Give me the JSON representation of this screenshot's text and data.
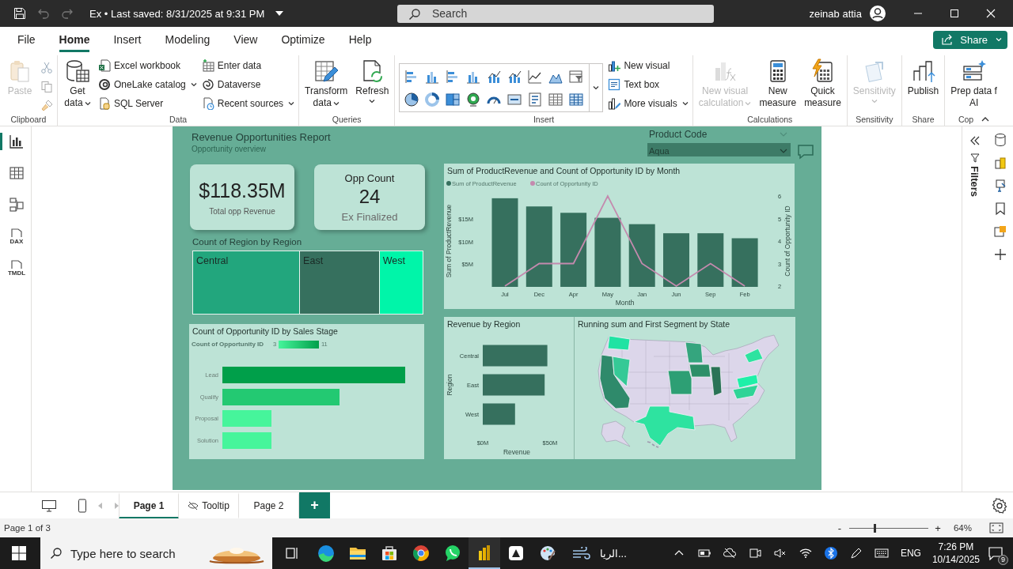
{
  "window": {
    "title": "Ex • Last saved: 8/31/2025 at 9:31 PM",
    "search_placeholder": "Search",
    "user": "zeinab attia"
  },
  "menu": [
    {
      "label": "File",
      "selected": false
    },
    {
      "label": "Home",
      "selected": true
    },
    {
      "label": "Insert",
      "selected": false
    },
    {
      "label": "Modeling",
      "selected": false
    },
    {
      "label": "View",
      "selected": false
    },
    {
      "label": "Optimize",
      "selected": false
    },
    {
      "label": "Help",
      "selected": false
    }
  ],
  "share_button": "Share",
  "ribbon": [
    {
      "label": "Clipboard",
      "items": [
        {
          "kind": "large",
          "label": "Paste",
          "dropdown": false,
          "disabled": true
        },
        {
          "kind": "tools"
        }
      ]
    },
    {
      "label": "Data",
      "items": [
        {
          "kind": "large",
          "label": "Get\ndata",
          "dropdown": true,
          "disabled": false
        },
        {
          "kind": "stack",
          "items": [
            {
              "label": "Excel workbook",
              "dropdown": false
            },
            {
              "label": "OneLake catalog",
              "dropdown": true
            },
            {
              "label": "SQL Server",
              "dropdown": false
            }
          ]
        },
        {
          "kind": "stack",
          "items": [
            {
              "label": "Enter data",
              "dropdown": false
            },
            {
              "label": "Dataverse",
              "dropdown": false
            },
            {
              "label": "Recent sources",
              "dropdown": true
            }
          ]
        }
      ]
    },
    {
      "label": "Queries",
      "items": [
        {
          "kind": "large",
          "label": "Transform\ndata",
          "dropdown": true,
          "disabled": false
        },
        {
          "kind": "large",
          "label": "Refresh",
          "dropdown": true,
          "disabled": false
        }
      ]
    },
    {
      "label": "Insert",
      "items": [
        {
          "kind": "gallery"
        },
        {
          "kind": "stack",
          "items": [
            {
              "label": "New visual",
              "dropdown": false
            },
            {
              "label": "Text box",
              "dropdown": false
            },
            {
              "label": "More visuals",
              "dropdown": true
            }
          ]
        }
      ]
    },
    {
      "label": "Calculations",
      "items": [
        {
          "kind": "large",
          "label": "New visual\ncalculation",
          "dropdown": true,
          "disabled": true
        },
        {
          "kind": "large",
          "label": "New\nmeasure",
          "dropdown": false,
          "disabled": false
        },
        {
          "kind": "large",
          "label": "Quick\nmeasure",
          "dropdown": false,
          "disabled": false
        }
      ]
    },
    {
      "label": "Sensitivity",
      "items": [
        {
          "kind": "large",
          "label": "Sensitivity",
          "dropdown": true,
          "disabled": true
        }
      ]
    },
    {
      "label": "Share",
      "items": [
        {
          "kind": "large",
          "label": "Publish",
          "dropdown": false,
          "disabled": false
        }
      ]
    },
    {
      "label": "Cop",
      "items": [
        {
          "kind": "large",
          "label": "Prep data f\nAI",
          "dropdown": false,
          "disabled": false
        }
      ]
    }
  ],
  "left_rail": [
    {
      "kind": "report",
      "selected": true
    },
    {
      "kind": "table",
      "selected": false
    },
    {
      "kind": "model",
      "selected": false
    },
    {
      "kind": "dax",
      "label": "DAX",
      "selected": false
    },
    {
      "kind": "tmdl",
      "label": "TMDL",
      "selected": false
    }
  ],
  "report": {
    "title": "Revenue Opportunities Report",
    "subtitle": "Opportunity overview",
    "slicer": {
      "label": "Product Code",
      "value": "Aqua"
    },
    "cards": [
      {
        "value": "$118.35M",
        "label": "Total opp Revenue"
      },
      {
        "heading": "Opp Count",
        "value": "24",
        "label": "Ex Finalized"
      }
    ],
    "treemap": {
      "title": "Count of Region by Region",
      "tiles": [
        {
          "label": "Central",
          "color": "#22a67d"
        },
        {
          "label": "East",
          "color": "#36705e"
        },
        {
          "label": "West",
          "color": "#00f5a9"
        }
      ]
    },
    "combo_chart": {
      "title": "Sum of ProductRevenue and Count of Opportunity ID by Month",
      "bars": {
        "chart_data": {
          "type": "bar",
          "xlabel": "Month",
          "ylabel": "Sum of ProductRevenue",
          "categories": [
            "Jul",
            "Dec",
            "Apr",
            "May",
            "Jan",
            "Jun",
            "Sep",
            "Feb"
          ],
          "series": [
            {
              "name": "Sum of ProductRevenue",
              "color": "#36705e",
              "values": [
                19.5,
                17.7,
                16.3,
                15.2,
                13.8,
                11.8,
                11.8,
                10.7
              ]
            }
          ],
          "ylim": [
            0,
            20
          ],
          "yticks": [
            {
              "value": 5,
              "label": "$5M"
            },
            {
              "value": 10,
              "label": "$10M"
            },
            {
              "value": 15,
              "label": "$15M"
            }
          ]
        }
      },
      "line": {
        "chart_data": {
          "type": "line",
          "ylabel": "Count of Opportunity ID",
          "series": [
            {
              "name": "Count of Opportunity ID",
              "color": "#c48aae",
              "values": [
                2,
                3,
                3,
                6,
                3,
                2,
                3,
                2
              ]
            }
          ],
          "ylim": [
            2,
            6
          ],
          "yticks": [
            2,
            3,
            4,
            5,
            6
          ]
        }
      }
    },
    "sales_stage_chart": {
      "title": "Count of Opportunity ID by Sales Stage",
      "legend": {
        "label": "Count of Opportunity ID",
        "min": {
          "label": "3",
          "color": "#46f59b"
        },
        "max": {
          "label": "11",
          "color": "#009f4a"
        }
      },
      "stages": [
        {
          "label": "Lead"
        },
        {
          "label": "Qualify"
        },
        {
          "label": "Proposal"
        },
        {
          "label": "Solution"
        }
      ]
    },
    "region_chart": {
      "title": "Revenue by Region",
      "chart_data": {
        "type": "bar",
        "orientation": "horizontal",
        "xlabel": "Revenue",
        "ylabel": "Region",
        "categories": [
          "Central",
          "East",
          "West"
        ],
        "values": [
          48,
          46,
          24
        ],
        "xlim": [
          0,
          50
        ],
        "xticks": [
          {
            "value": 0,
            "label": "$0M"
          },
          {
            "value": 50,
            "label": "$50M"
          }
        ]
      }
    },
    "map": {
      "title": "Running sum and First Segment by State"
    }
  },
  "right_pane": {
    "filters_label": "Filters"
  },
  "page_tabs": [
    {
      "label": "Page 1",
      "selected": true,
      "hidden": false
    },
    {
      "label": "Tooltip",
      "selected": false,
      "hidden": true
    },
    {
      "label": "Page 2",
      "selected": false,
      "hidden": false
    }
  ],
  "add_page": "+",
  "status_bar": {
    "page_info": "Page 1 of 3",
    "zoom_out": "-",
    "zoom_in": "+",
    "zoom": {
      "level": 0.31
    },
    "zoom_reading": "64%"
  },
  "taskbar": {
    "search_placeholder": "Type here to search",
    "apps": [
      {
        "kind": "browser",
        "active": false
      },
      {
        "kind": "folder",
        "active": false
      },
      {
        "kind": "store",
        "active": false
      },
      {
        "kind": "web",
        "active": false
      },
      {
        "kind": "chat",
        "active": false
      },
      {
        "kind": "chart",
        "active": true
      },
      {
        "kind": "tile",
        "active": false
      },
      {
        "kind": "palette",
        "active": false
      }
    ],
    "weather": "الريا...",
    "language": "ENG",
    "time": "7:26 PM",
    "date": "10/14/2025",
    "notifications": "9"
  }
}
